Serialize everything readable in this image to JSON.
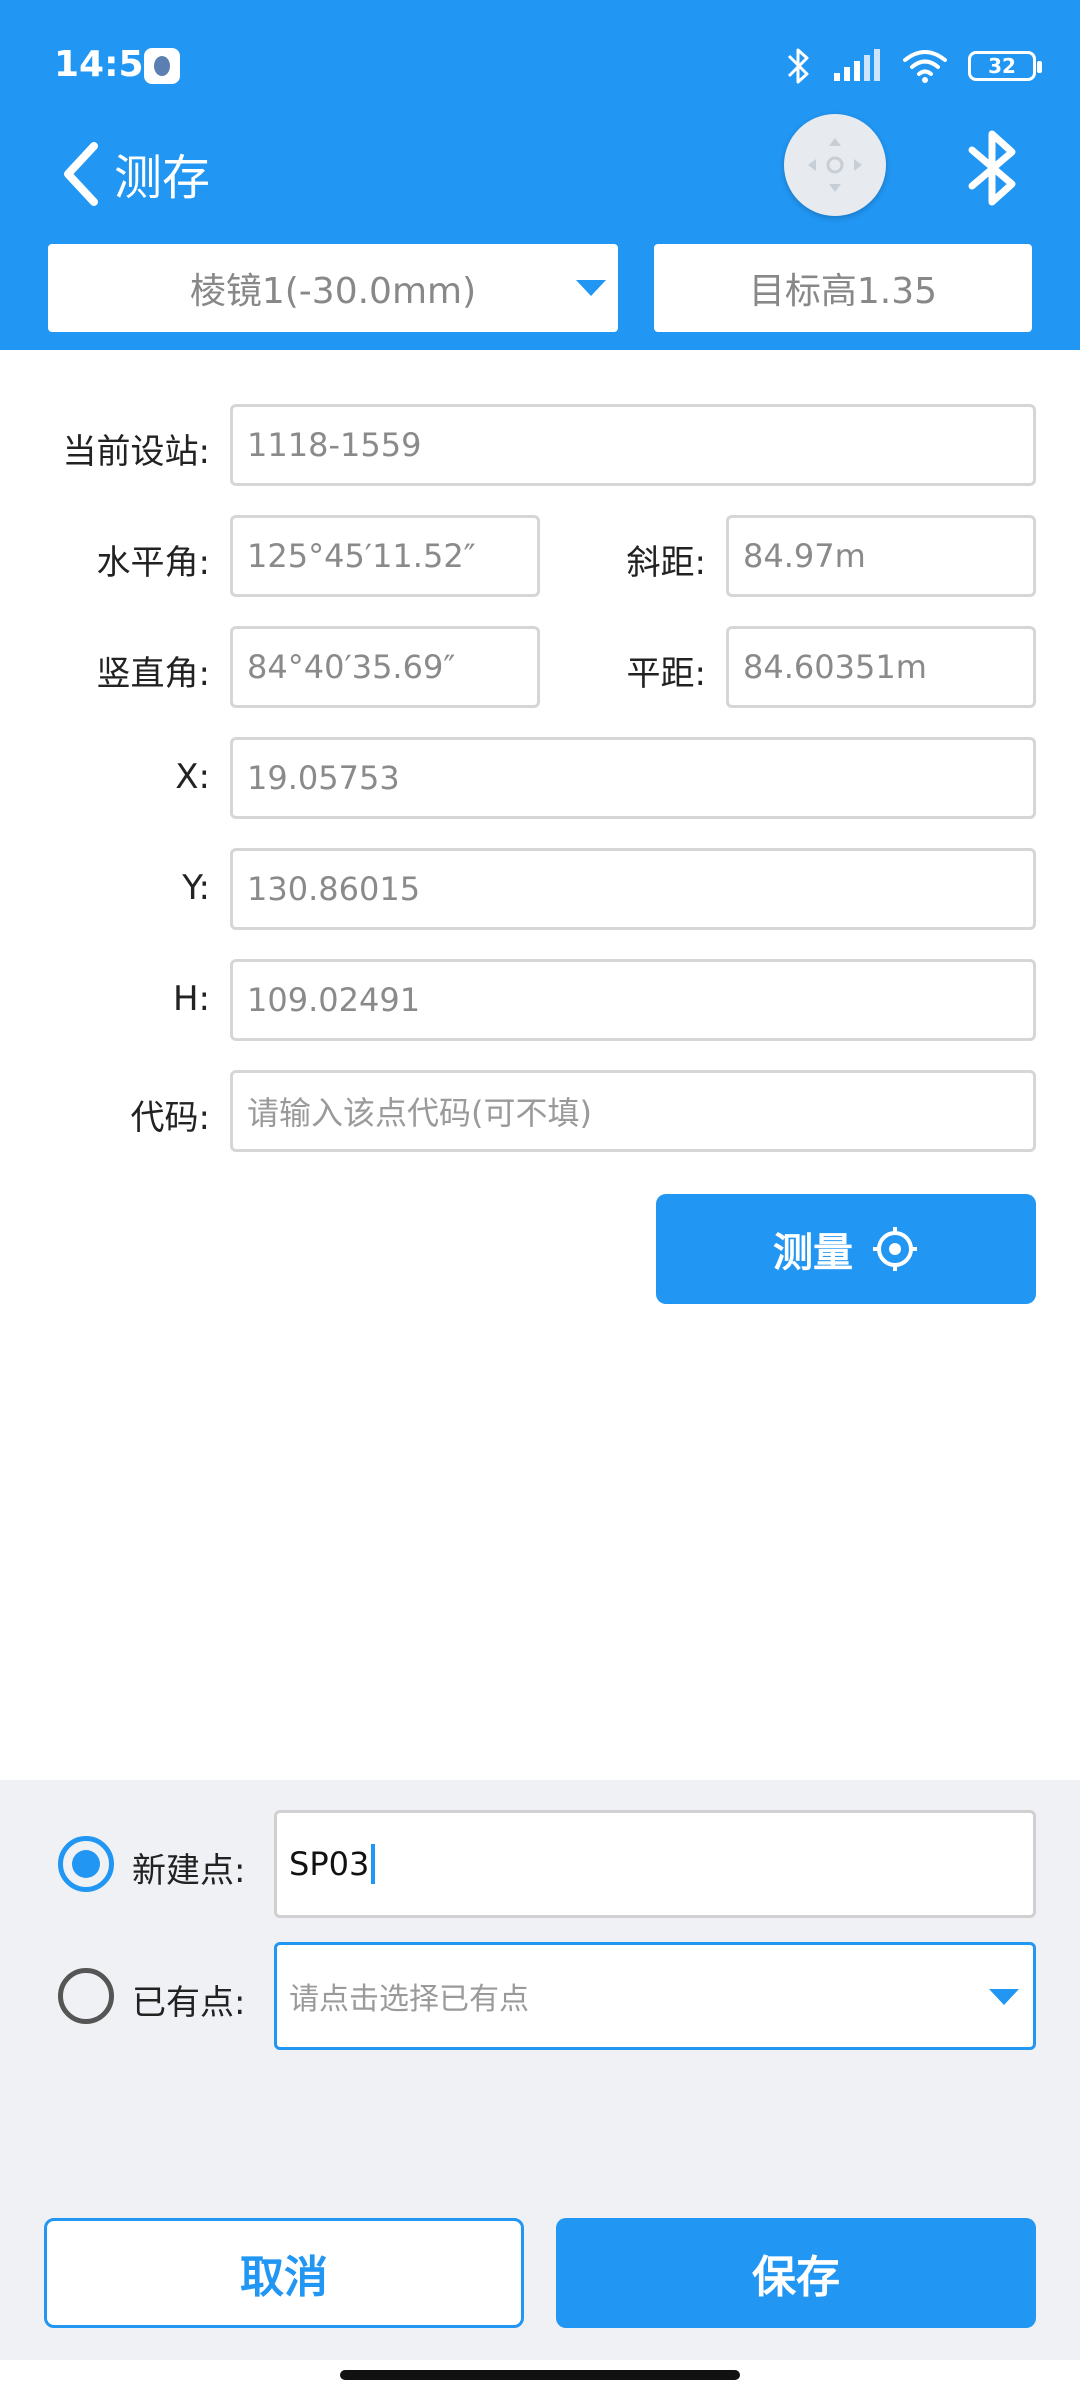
{
  "status_bar": {
    "time": "14:51",
    "battery": "32"
  },
  "nav": {
    "title": "测存"
  },
  "toolbar": {
    "prism": "棱镜1(-30.0mm)",
    "target_height": "目标高1.35"
  },
  "form": {
    "station": {
      "label": "当前设站:",
      "value": "1118-1559"
    },
    "hz_angle": {
      "label": "水平角:",
      "value": "125°45′11.52″"
    },
    "slope_dist": {
      "label": "斜距:",
      "value": "84.97m"
    },
    "v_angle": {
      "label": "竖直角:",
      "value": "84°40′35.69″"
    },
    "horiz_dist": {
      "label": "平距:",
      "value": "84.60351m"
    },
    "x": {
      "label": "X:",
      "value": "19.05753"
    },
    "y": {
      "label": "Y:",
      "value": "130.86015"
    },
    "h": {
      "label": "H:",
      "value": "109.02491"
    },
    "code": {
      "label": "代码:",
      "placeholder": "请输入该点代码(可不填)"
    }
  },
  "measure_button": {
    "label": "测量"
  },
  "point": {
    "new_label": "新建点:",
    "new_value": "SP03",
    "existing_label": "已有点:",
    "existing_placeholder": "请点击选择已有点"
  },
  "actions": {
    "cancel": "取消",
    "save": "保存"
  },
  "colors": {
    "accent": "#2196F3",
    "bottom_bg": "#eff1f5"
  }
}
